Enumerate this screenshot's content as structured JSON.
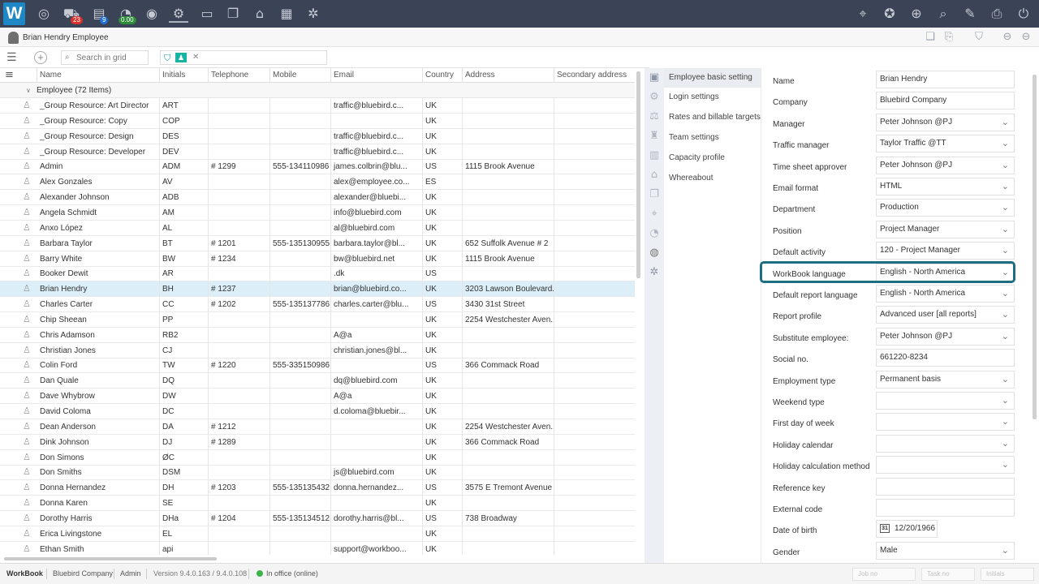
{
  "app": {
    "logo": "W"
  },
  "topbar": {
    "badge_red": "23",
    "badge_blue": "9",
    "badge_green": "0.00",
    "colors": {
      "bar": "#3b4356",
      "logo": "#1e88c7",
      "badge_red": "#d9312b",
      "badge_blue": "#1e6fd9",
      "badge_green": "#2e8b3a"
    }
  },
  "user": {
    "name": "Brian Hendry",
    "role": "Employee"
  },
  "grid_toolbar": {
    "search_placeholder": "Search in grid"
  },
  "grid": {
    "columns": [
      "Name",
      "Initials",
      "Telephone",
      "Mobile",
      "Email",
      "Country",
      "Address",
      "Secondary address"
    ],
    "group_label": "Employee (72 Items)",
    "rows": [
      [
        "_Group Resource: Art Director",
        "ART",
        "",
        "",
        "traffic@bluebird.c...",
        "UK",
        "",
        ""
      ],
      [
        "_Group Resource: Copy",
        "COP",
        "",
        "",
        "",
        "UK",
        "",
        ""
      ],
      [
        "_Group Resource: Design",
        "DES",
        "",
        "",
        "traffic@bluebird.c...",
        "UK",
        "",
        ""
      ],
      [
        "_Group Resource: Developer",
        "DEV",
        "",
        "",
        "traffic@bluebird.c...",
        "UK",
        "",
        ""
      ],
      [
        "Admin",
        "ADM",
        "# 1299",
        "555-134110986",
        "james.colbrin@blu...",
        "US",
        "1115 Brook Avenue",
        ""
      ],
      [
        "Alex Gonzales",
        "AV",
        "",
        "",
        "alex@employee.co...",
        "ES",
        "",
        ""
      ],
      [
        "Alexander Johnson",
        "ADB",
        "",
        "",
        "alexander@bluebi...",
        "UK",
        "",
        ""
      ],
      [
        "Angela Schmidt",
        "AM",
        "",
        "",
        "info@bluebird.com",
        "UK",
        "",
        ""
      ],
      [
        "Anxo López",
        "AL",
        "",
        "",
        "al@bluebird.com",
        "UK",
        "",
        ""
      ],
      [
        "Barbara Taylor",
        "BT",
        "# 1201",
        "555-135130955",
        "barbara.taylor@bl...",
        "UK",
        "652 Suffolk Avenue # 2",
        ""
      ],
      [
        "Barry White",
        "BW",
        "# 1234",
        "",
        "bw@bluebird.net",
        "UK",
        "1115 Brook Avenue",
        ""
      ],
      [
        "Booker Dewit",
        "AR",
        "",
        "",
        ".dk",
        "US",
        "",
        ""
      ],
      [
        "Brian Hendry",
        "BH",
        "# 1237",
        "",
        "brian@bluebird.co...",
        "UK",
        "3203 Lawson Boulevard...",
        ""
      ],
      [
        "Charles Carter",
        "CC",
        "# 1202",
        "555-135137786",
        "charles.carter@blu...",
        "US",
        "3430 31st Street",
        ""
      ],
      [
        "Chip Sheean",
        "PP",
        "",
        "",
        "",
        "UK",
        "2254 Westchester Aven...",
        ""
      ],
      [
        "Chris Adamson",
        "RB2",
        "",
        "",
        "A@a",
        "UK",
        "",
        ""
      ],
      [
        "Christian Jones",
        "CJ",
        "",
        "",
        "christian.jones@bl...",
        "UK",
        "",
        ""
      ],
      [
        "Colin Ford",
        "TW",
        "# 1220",
        "555-335150986",
        "",
        "US",
        "366 Commack Road",
        ""
      ],
      [
        "Dan Quale",
        "DQ",
        "",
        "",
        "dq@bluebird.com",
        "UK",
        "",
        ""
      ],
      [
        "Dave Whybrow",
        "DW",
        "",
        "",
        "A@a",
        "UK",
        "",
        ""
      ],
      [
        "David Coloma",
        "DC",
        "",
        "",
        "d.coloma@bluebir...",
        "UK",
        "",
        ""
      ],
      [
        "Dean Anderson",
        "DA",
        "# 1212",
        "",
        "",
        "UK",
        "2254 Westchester Aven...",
        ""
      ],
      [
        "Dink Johnson",
        "DJ",
        "# 1289",
        "",
        "",
        "UK",
        "366 Commack Road",
        ""
      ],
      [
        "Don Simons",
        "ØC",
        "",
        "",
        "",
        "UK",
        "",
        ""
      ],
      [
        "Don Smiths",
        "DSM",
        "",
        "",
        "js@bluebird.com",
        "UK",
        "",
        ""
      ],
      [
        "Donna Hernandez",
        "DH",
        "# 1203",
        "555-135135432",
        "donna.hernandez...",
        "US",
        "3575 E Tremont Avenue",
        ""
      ],
      [
        "Donna Karen",
        "SE",
        "",
        "",
        "",
        "UK",
        "",
        ""
      ],
      [
        "Dorothy Harris",
        "DHa",
        "# 1204",
        "555-135134512",
        "dorothy.harris@bl...",
        "US",
        "738 Broadway",
        ""
      ],
      [
        "Erica Livingstone",
        "EL",
        "",
        "",
        "",
        "UK",
        "",
        ""
      ],
      [
        "Ethan Smith",
        "api",
        "",
        "",
        "support@workboo...",
        "UK",
        "",
        ""
      ]
    ]
  },
  "nav": {
    "items": [
      "Employee basic setting",
      "Login settings",
      "Rates and billable targets",
      "Team settings",
      "Capacity profile",
      "Whereabout"
    ]
  },
  "form": {
    "fields": [
      {
        "label": "Name",
        "value": "Brian Hendry",
        "type": "text"
      },
      {
        "label": "Company",
        "value": "Bluebird Company",
        "type": "text"
      },
      {
        "label": "Manager",
        "value": "Peter Johnson  @PJ",
        "type": "select"
      },
      {
        "label": "Traffic manager",
        "value": "Taylor Traffic  @TT",
        "type": "select"
      },
      {
        "label": "Time sheet approver",
        "value": "Peter Johnson  @PJ",
        "type": "select"
      },
      {
        "label": "Email format",
        "value": "HTML",
        "type": "select"
      },
      {
        "label": "Department",
        "value": "Production",
        "type": "select"
      },
      {
        "label": "Position",
        "value": "Project Manager",
        "type": "select"
      },
      {
        "label": "Default activity",
        "value": "120 - Project Manager",
        "type": "select"
      },
      {
        "label": "WorkBook language",
        "value": "English - North America",
        "type": "select"
      },
      {
        "label": "Default report language",
        "value": "English - North America",
        "type": "select"
      },
      {
        "label": "Report profile",
        "value": "Advanced user [all reports]",
        "type": "select"
      },
      {
        "label": "Substitute employee:",
        "value": "Peter Johnson  @PJ",
        "type": "select"
      },
      {
        "label": "Social no.",
        "value": "661220-8234",
        "type": "text"
      },
      {
        "label": "Employment type",
        "value": "Permanent basis",
        "type": "select"
      },
      {
        "label": "Weekend type",
        "value": "",
        "type": "select"
      },
      {
        "label": "First day of week",
        "value": "",
        "type": "select"
      },
      {
        "label": "Holiday calendar",
        "value": "",
        "type": "select"
      },
      {
        "label": "Holiday calculation method",
        "value": "",
        "type": "select"
      },
      {
        "label": "Reference key",
        "value": "",
        "type": "text"
      },
      {
        "label": "External code",
        "value": "",
        "type": "text"
      },
      {
        "label": "Date of birth",
        "value": "12/20/1966",
        "type": "date",
        "icon_text": "31"
      },
      {
        "label": "Gender",
        "value": "Male",
        "type": "select"
      }
    ],
    "highlight_color": "#1d6e82"
  },
  "status": {
    "app": "WorkBook",
    "company": "Bluebird Company",
    "user": "Admin",
    "version": "Version 9.4.0.163 / 9.4.0.108",
    "presence": "In office (online)",
    "job_placeholder": "Job no",
    "task_placeholder": "Task no",
    "initials_placeholder": "Initials"
  }
}
